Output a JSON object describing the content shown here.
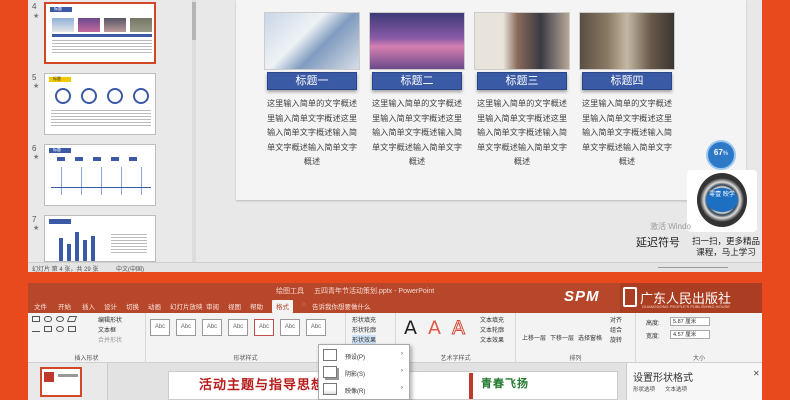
{
  "top_window": {
    "thumbnails": [
      {
        "num": "4",
        "star": "★",
        "header": "标题"
      },
      {
        "num": "5",
        "star": "★",
        "header": "标题"
      },
      {
        "num": "6",
        "star": "★",
        "header": "标题"
      },
      {
        "num": "7",
        "star": "★",
        "header": ""
      }
    ],
    "cards": [
      {
        "title": "标题一",
        "text": "这里输入简单的文字概述里输入简单文字概述这里输入简单文字概述输入简单文字概述输入简单文字概述"
      },
      {
        "title": "标题二",
        "text": "这里输入简单的文字概述里输入简单文字概述这里输入简单文字概述输入简单文字概述输入简单文字概述"
      },
      {
        "title": "标题三",
        "text": "这里输入简单的文字概述里输入简单文字概述这里输入简单文字概述输入简单文字概述输入简单文字概述"
      },
      {
        "title": "标题四",
        "text": "这里输入简单的文字概述里输入简单文字概述这里输入简单文字概述输入简单文字概述输入简单文字概述"
      }
    ],
    "badge": {
      "value": "67",
      "unit": "%"
    },
    "qr_logo_text": "零壹 映学",
    "watermark": "激活 Windo",
    "delayed_symbol": "延迟符号",
    "promo_line1": "扫一扫，更多精品",
    "promo_line2": "课程，马上学习",
    "status": {
      "left": "幻灯片 第 4 张，共 29 张",
      "lang": "中文(中国)"
    }
  },
  "bottom_window": {
    "tool_context": "绘图工具",
    "file_title": "五四青年节活动策划.pptx - PowerPoint",
    "tabs": [
      "文件",
      "开始",
      "插入",
      "设计",
      "切换",
      "动画",
      "幻灯片放映",
      "审阅",
      "视图",
      "帮助",
      "格式"
    ],
    "active_tab": "格式",
    "tell_me": "告诉我你想要做什么",
    "spm": "SPM",
    "publisher_cn": "广东人民出版社",
    "publisher_en": "GUANGDONG PEOPLE'S PUBLISHING HOUSE",
    "ribbon": {
      "edit_shape": "编辑形状",
      "text_box": "文本框",
      "merge_shapes": "合并形状",
      "insert_shapes_label": "插入形状",
      "shape_styles_label": "形状样式",
      "style_sample": "Abc",
      "shape_fill": "形状填充",
      "shape_outline": "形状轮廓",
      "shape_effects": "形状效果",
      "wordart_label": "艺术字样式",
      "text_fill": "文本填充",
      "text_outline": "文本轮廓",
      "text_effects": "文本效果",
      "bring_forward": "上移一层",
      "send_backward": "下移一层",
      "selection_pane": "选择窗格",
      "align": "对齐",
      "group": "组合",
      "rotate": "旋转",
      "arrange_label": "排列",
      "height_label": "高度:",
      "height_value": "5.87 厘米",
      "width_label": "宽度:",
      "width_value": "4.57 厘米",
      "size_label": "大小"
    },
    "effects_menu": [
      "预设(P)",
      "阴影(S)",
      "映像(R)"
    ],
    "slide_title": "活动主题与指导思想",
    "slide_green": "青春飞扬",
    "pane_title": "设置形状格式",
    "pane_tabs": [
      "形状选项",
      "文本选项"
    ]
  },
  "colors": {
    "background": "#e84a1e",
    "ppt_red": "#b7472a",
    "card_blue": "#3a5aa6"
  }
}
